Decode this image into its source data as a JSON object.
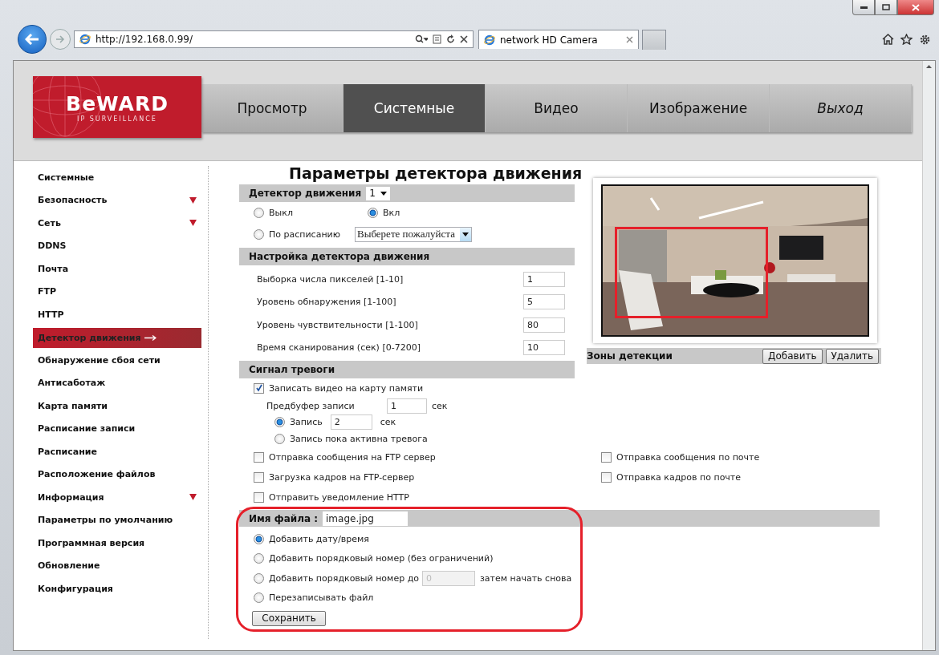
{
  "browser": {
    "url": "http://192.168.0.99/",
    "tab_title": "network HD Camera"
  },
  "logo": {
    "name": "BeWARD",
    "tagline": "IP SURVEILLANCE"
  },
  "nav": [
    {
      "label": "Просмотр",
      "selected": false,
      "italic": false
    },
    {
      "label": "Системные",
      "selected": true,
      "italic": false
    },
    {
      "label": "Видео",
      "selected": false,
      "italic": false
    },
    {
      "label": "Изображение",
      "selected": false,
      "italic": false
    },
    {
      "label": "Выход",
      "selected": false,
      "italic": true
    }
  ],
  "sidebar": [
    {
      "label": "Системные",
      "selected": false,
      "expandable": false
    },
    {
      "label": "Безопасность",
      "selected": false,
      "expandable": true
    },
    {
      "label": "Сеть",
      "selected": false,
      "expandable": true
    },
    {
      "label": "DDNS",
      "selected": false,
      "expandable": false
    },
    {
      "label": "Почта",
      "selected": false,
      "expandable": false
    },
    {
      "label": "FTP",
      "selected": false,
      "expandable": false
    },
    {
      "label": "HTTP",
      "selected": false,
      "expandable": false
    },
    {
      "label": "Детектор движения",
      "selected": true,
      "expandable": false
    },
    {
      "label": "Обнаружение сбоя сети",
      "selected": false,
      "expandable": false
    },
    {
      "label": "Антисаботаж",
      "selected": false,
      "expandable": false
    },
    {
      "label": "Карта памяти",
      "selected": false,
      "expandable": false
    },
    {
      "label": "Расписание записи",
      "selected": false,
      "expandable": false
    },
    {
      "label": "Расписание",
      "selected": false,
      "expandable": false
    },
    {
      "label": "Расположение файлов",
      "selected": false,
      "expandable": false
    },
    {
      "label": "Информация",
      "selected": false,
      "expandable": true
    },
    {
      "label": "Параметры по умолчанию",
      "selected": false,
      "expandable": false
    },
    {
      "label": "Программная версия",
      "selected": false,
      "expandable": false
    },
    {
      "label": "Обновление",
      "selected": false,
      "expandable": false
    },
    {
      "label": "Конфигурация",
      "selected": false,
      "expandable": false
    }
  ],
  "title": "Параметры детектора движения",
  "detector": {
    "label": "Детектор движения",
    "value": "1"
  },
  "modes": [
    {
      "label": "Выкл",
      "selected": false
    },
    {
      "label": "Вкл",
      "selected": true
    },
    {
      "label": "По расписанию",
      "selected": false
    }
  ],
  "schedule_select": "Выберете пожалуйста",
  "settings": {
    "title": "Настройка детектора движения",
    "fields": [
      {
        "label": "Выборка числа пикселей [1-10]",
        "value": "1"
      },
      {
        "label": "Уровень обнаружения [1-100]",
        "value": "5"
      },
      {
        "label": "Уровень чувствительности [1-100]",
        "value": "80"
      },
      {
        "label": "Время сканирования (сек) [0-7200]",
        "value": "10"
      }
    ]
  },
  "alarm": {
    "title": "Сигнал тревоги",
    "record": {
      "label": "Записать видео на карту памяти",
      "checked": true
    },
    "prebuffer": {
      "label": "Предбуфер записи",
      "value": "1",
      "unit": "сек"
    },
    "record_modes": [
      {
        "kind": "timed",
        "label": "Запись",
        "value": "2",
        "unit": "сек",
        "selected": true
      },
      {
        "kind": "plain",
        "label": "Запись пока активна тревога",
        "selected": false
      }
    ],
    "actions": [
      {
        "label": "Отправка сообщения на FTP сервер",
        "checked": false
      },
      {
        "label": "Отправка сообщения по почте",
        "checked": false
      },
      {
        "label": "Загрузка кадров на FTP-сервер",
        "checked": false
      },
      {
        "label": "Отправка кадров по почте",
        "checked": false
      },
      {
        "label": "Отправить уведомление HTTP",
        "checked": false
      }
    ]
  },
  "preview": {
    "zones_title": "Зоны детекции",
    "buttons": [
      "Добавить",
      "Удалить"
    ]
  },
  "file": {
    "label": "Имя файла :",
    "value": "image.jpg",
    "options": [
      {
        "kind": "plain",
        "label": "Добавить дату/время",
        "selected": true
      },
      {
        "kind": "plain",
        "label": "Добавить порядковый номер (без ограничений)",
        "selected": false
      },
      {
        "kind": "limit",
        "label": "Добавить порядковый номер до",
        "placeholder": "0",
        "after": "затем начать снова",
        "selected": false
      },
      {
        "kind": "plain",
        "label": "Перезаписывать файл",
        "selected": false
      }
    ],
    "save": "Сохранить"
  }
}
